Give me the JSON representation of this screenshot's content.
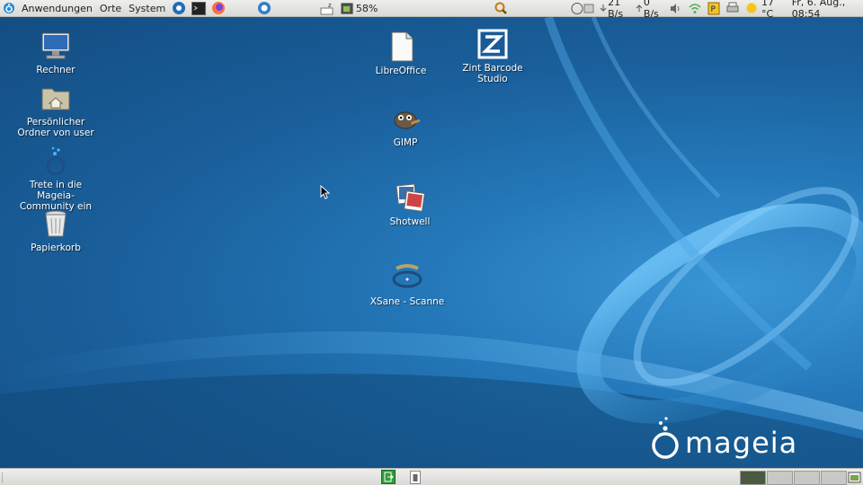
{
  "top_panel": {
    "menus": [
      "Anwendungen",
      "Orte",
      "System"
    ],
    "battery": "58%",
    "net_down": "21 B/s",
    "net_up": "0 B/s",
    "weather": "17 °C",
    "clock": "Fr,  6. Aug., 08:54"
  },
  "desktop": {
    "icons_left": [
      {
        "label": "Rechner"
      },
      {
        "label": "Persönlicher Ordner von user"
      },
      {
        "label": "Trete in die Mageia-Community ein"
      },
      {
        "label": "Papierkorb"
      }
    ],
    "icons_center": [
      {
        "label": "LibreOffice"
      },
      {
        "label": "Zint Barcode Studio"
      },
      {
        "label": "GIMP"
      },
      {
        "label": "Shotwell"
      },
      {
        "label": "XSane - Scanne"
      }
    ],
    "brand": "mageia"
  },
  "colors": {
    "panel": "#e6e6e3",
    "desktop": "#1b5f99",
    "accent": "#2c8ad0"
  }
}
